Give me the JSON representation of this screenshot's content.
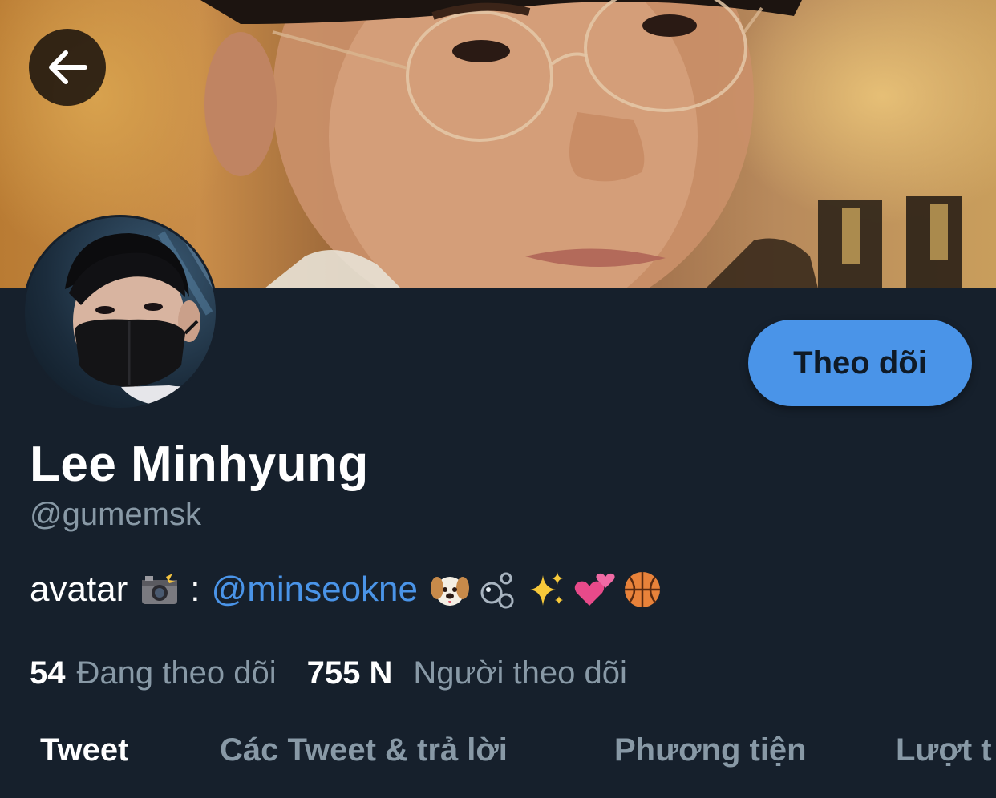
{
  "header": {
    "back_icon": "arrow-left-icon"
  },
  "profile": {
    "follow_label": "Theo dõi",
    "display_name": "Lee Minhyung",
    "handle": "@gumemsk",
    "bio": {
      "prefix": "avatar",
      "camera_emoji": "camera-flash-icon",
      "separator": ":",
      "mention": "@minseokne",
      "emojis": [
        "dog-face-icon",
        "bubbles-icon",
        "sparkles-icon",
        "two-hearts-icon",
        "basketball-icon"
      ]
    },
    "stats": {
      "following_count": "54",
      "following_label": "Đang theo dõi",
      "followers_count": "755 N",
      "followers_label": "Người theo dõi"
    }
  },
  "tabs": [
    {
      "label": "Tweet",
      "active": true
    },
    {
      "label": "Các Tweet & trả lời",
      "active": false
    },
    {
      "label": "Phương tiện",
      "active": false
    },
    {
      "label": "Lượt t",
      "active": false
    }
  ],
  "colors": {
    "background": "#16202c",
    "accent": "#4a94e8",
    "secondary_text": "#8899a6",
    "primary_text": "#ffffff"
  }
}
